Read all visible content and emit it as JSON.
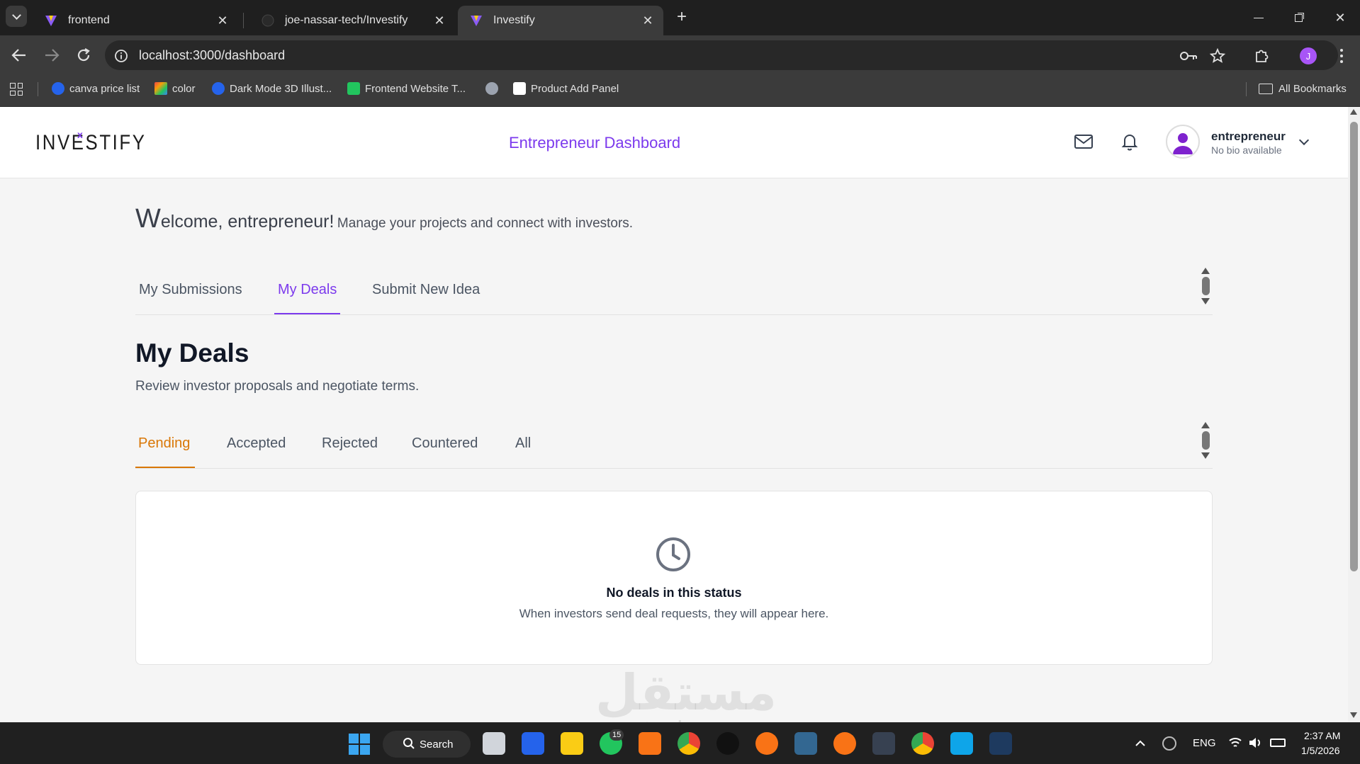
{
  "browser": {
    "tabs": [
      {
        "title": "frontend",
        "active": false
      },
      {
        "title": "joe-nassar-tech/Investify",
        "active": false
      },
      {
        "title": "Investify",
        "active": true
      }
    ],
    "new_tab_label": "+",
    "url": "localhost:3000/dashboard",
    "profile_initial": "J",
    "bookmarks": [
      {
        "label": "canva price list",
        "color": "#2563eb"
      },
      {
        "label": "color",
        "color": "#f59e0b"
      },
      {
        "label": "Dark Mode 3D Illust...",
        "color": "#2563eb"
      },
      {
        "label": "Frontend Website T...",
        "color": "#22c55e"
      },
      {
        "label": "",
        "color": "#9ca3af"
      },
      {
        "label": "Product Add Panel",
        "color": "#ffffff"
      }
    ],
    "all_bookmarks_label": "All Bookmarks"
  },
  "app": {
    "logo_text": "INVESTIFY",
    "header_title": "Entrepreneur Dashboard",
    "user": {
      "name": "entrepreneur",
      "bio": "No bio available"
    },
    "welcome": {
      "big_letter": "W",
      "greeting_rest": "elcome, entrepreneur!",
      "subtitle": "Manage your projects and connect with investors."
    },
    "tabs": [
      {
        "label": "My Submissions",
        "active": false
      },
      {
        "label": "My Deals",
        "active": true
      },
      {
        "label": "Submit New Idea",
        "active": false
      }
    ],
    "section": {
      "title": "My Deals",
      "subtitle": "Review investor proposals and negotiate terms."
    },
    "status_tabs": [
      {
        "label": "Pending",
        "active": true
      },
      {
        "label": "Accepted",
        "active": false
      },
      {
        "label": "Rejected",
        "active": false
      },
      {
        "label": "Countered",
        "active": false
      },
      {
        "label": "All",
        "active": false
      }
    ],
    "empty_state": {
      "title": "No deals in this status",
      "message": "When investors send deal requests, they will appear here."
    },
    "accent_color": "#7c3aed",
    "status_active_color": "#d97706"
  },
  "watermark": {
    "arabic": "مستقل",
    "latin": "mostaql.com"
  },
  "taskbar": {
    "search_label": "Search",
    "whatsapp_badge": "15",
    "language": "ENG",
    "time": "2:37 AM",
    "date": "1/5/2026"
  }
}
